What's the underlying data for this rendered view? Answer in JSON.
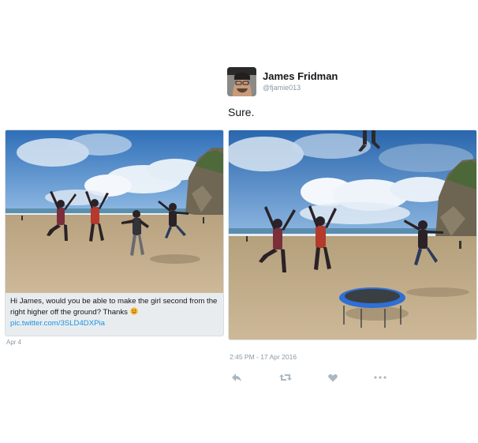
{
  "left_tweet": {
    "caption": "Hi James, would you be able to make the girl second from the right higher off the ground? Thanks",
    "emoji": "smiling-face-icon",
    "link": "pic.twitter.com/3SLD4DXPia",
    "date": "Apr 4"
  },
  "right_tweet": {
    "author_name": "James Fridman",
    "author_handle": "@fjamie013",
    "text": "Sure.",
    "timestamp": "2:45 PM - 17 Apr 2016",
    "actions": [
      "reply-icon",
      "retweet-icon",
      "like-icon",
      "more-icon"
    ]
  },
  "colors": {
    "link": "#1b95e0",
    "meta": "#8899a6",
    "icon": "#aab8c2",
    "card_bg": "#e9ecef",
    "trampoline": "#2f6fd6"
  }
}
